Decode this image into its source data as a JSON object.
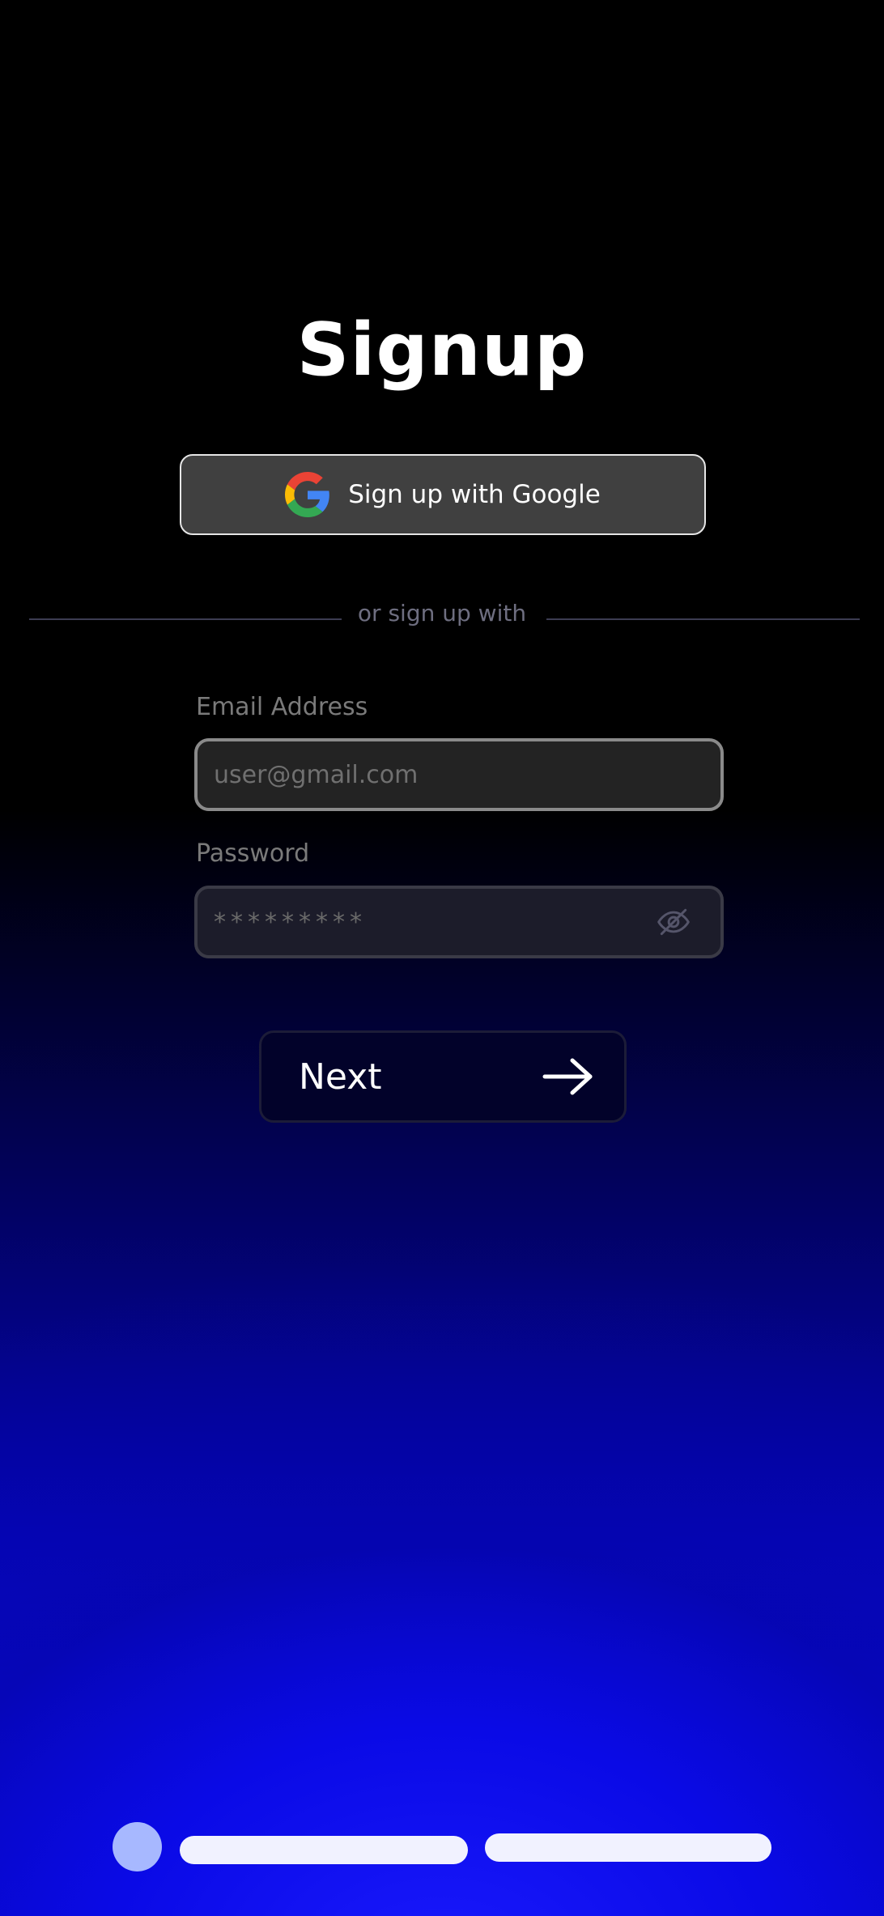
{
  "page": {
    "title": "Signup"
  },
  "google_button": {
    "label": "Sign up with Google"
  },
  "divider": {
    "text": "or sign up with"
  },
  "form": {
    "email": {
      "label": "Email Address",
      "placeholder": "user@gmail.com",
      "value": ""
    },
    "password": {
      "label": "Password",
      "placeholder": "*********",
      "value": ""
    }
  },
  "next_button": {
    "label": "Next"
  },
  "progress": {
    "total_steps": 3,
    "current_step": 1
  },
  "icons": {
    "google": "google-logo-icon",
    "password_toggle": "eye-off-icon",
    "next": "arrow-right-icon"
  },
  "colors": {
    "background_top": "#000000",
    "background_bottom": "#0a0ae8",
    "google_button_bg": "#404040",
    "google_button_border": "#e6e6e6",
    "divider_text": "#6e6e80",
    "field_label": "#7a7a7a",
    "email_border": "#8a8a8a",
    "next_button_bg": "#02022a",
    "step_active": "#a7b8ff",
    "step_inactive": "#f1f2ff"
  }
}
